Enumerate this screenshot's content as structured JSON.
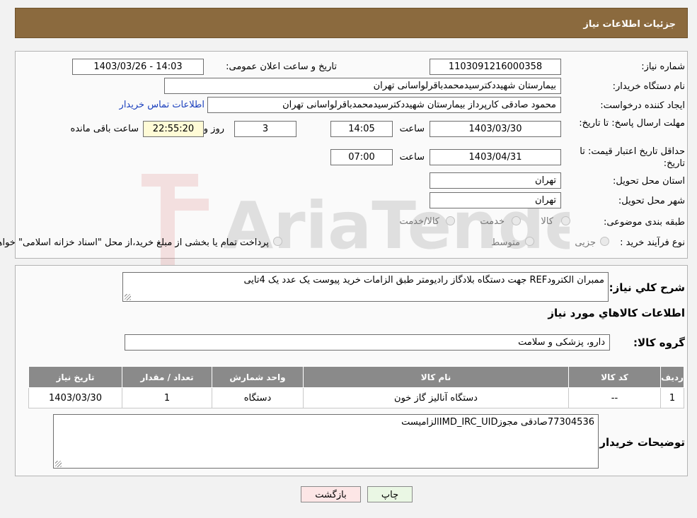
{
  "header": {
    "title": "جزئیات اطلاعات نیاز"
  },
  "info": {
    "need_number_label": "شماره نیاز:",
    "need_number": "1103091216000358",
    "announce_label": "تاریخ و ساعت اعلان عمومی:",
    "announce_value": "1403/03/26 - 14:03",
    "buyer_org_label": "نام دستگاه خریدار:",
    "buyer_org": "بیمارستان شهیددکترسیدمحمدباقرلواسانی تهران",
    "creator_label": "ایجاد کننده درخواست:",
    "creator": "محمود صادقی کارپرداز بیمارستان شهیددکترسیدمحمدباقرلواسانی تهران",
    "contact_link": "اطلاعات تماس خریدار",
    "deadline_label": "مهلت ارسال پاسخ: تا تاریخ:",
    "deadline_date": "1403/03/30",
    "time_label": "ساعت",
    "deadline_time": "14:05",
    "days_value": "3",
    "days_label": "روز و",
    "remaining_value": "22:55:20",
    "remaining_label": "ساعت باقی مانده",
    "validity_label": "حداقل تاریخ اعتبار قیمت: تا تاریخ:",
    "validity_date": "1403/04/31",
    "validity_time": "07:00",
    "province_label": "استان محل تحویل:",
    "province": "تهران",
    "city_label": "شهر محل تحویل:",
    "city": "تهران",
    "category_label": "طبقه بندی موضوعی:",
    "category_options": [
      "کالا",
      "خدمت",
      "کالا/خدمت"
    ],
    "purchase_type_label": "نوع فرآیند خرید :",
    "purchase_options": [
      "جزیی",
      "متوسط"
    ],
    "purchase_note": "پرداخت تمام یا بخشی از مبلغ خرید،از محل \"اسناد خزانه اسلامی\" خواهد بود."
  },
  "watermark": {
    "text": "AriaTender.neT"
  },
  "summary": {
    "label": "شرح کلي نياز:",
    "text": "ممبران الکترودREF جهت دستگاه بلادگاز رادیومتر طبق الزامات خرید پیوست یک عدد یک 4تایی"
  },
  "goods": {
    "section_title": "اطلاعات کالاهاي مورد نياز",
    "group_label": "گروه کالا:",
    "group_value": "دارو، پزشکی و سلامت",
    "columns": [
      "ردیف",
      "کد کالا",
      "نام کالا",
      "واحد شمارش",
      "تعداد / مقدار",
      "تاریخ نیاز"
    ],
    "rows": [
      [
        "1",
        "--",
        "دستگاه آنالیز گاز خون",
        "دستگاه",
        "1",
        "1403/03/30"
      ]
    ]
  },
  "buyer_notes": {
    "label": "توضیحات خریدار:",
    "text": "77304536صادقی مجوزIMD_IRC_UIDالزامیست"
  },
  "buttons": {
    "print": "چاپ",
    "back": "بازگشت"
  },
  "colors": {
    "header_bg": "#8b6a3e",
    "link": "#1a3fbd",
    "table_header": "#8a8a8a",
    "back_button": "#fde6e6",
    "print_button": "#eaf7e4"
  }
}
